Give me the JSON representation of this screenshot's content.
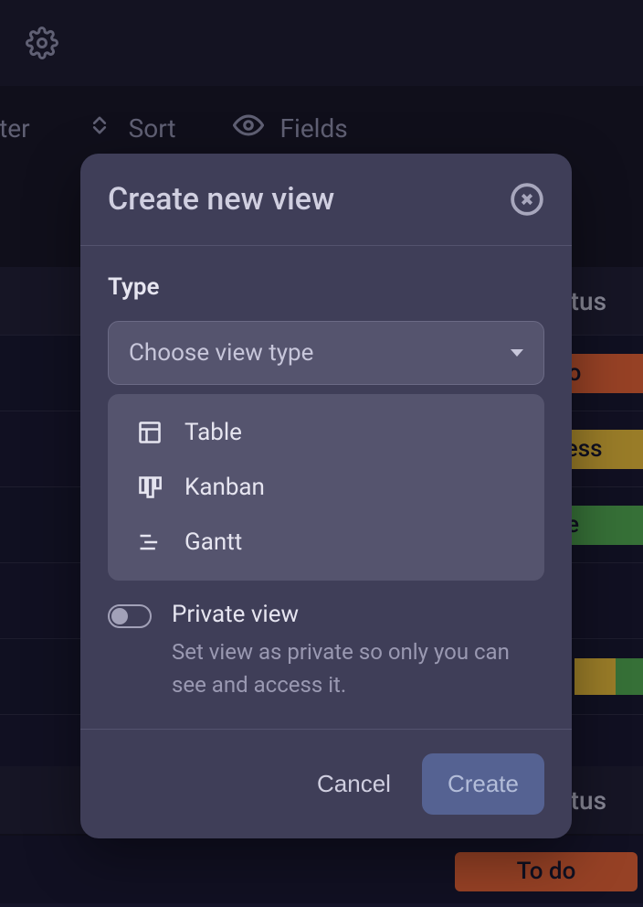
{
  "toolbar": {
    "filter": "Filter",
    "sort": "Sort",
    "fields": "Fields"
  },
  "table": {
    "header1": "Status",
    "header2": "Status",
    "rows": [
      {
        "status": "To do",
        "color": "todo"
      },
      {
        "status": "In progress",
        "color": "progress"
      },
      {
        "status": "Done",
        "color": "done"
      }
    ],
    "row2_status": "To do"
  },
  "modal": {
    "title": "Create new view",
    "type_label": "Type",
    "select_placeholder": "Choose view type",
    "options": {
      "table": "Table",
      "kanban": "Kanban",
      "gantt": "Gantt"
    },
    "private": {
      "title": "Private view",
      "desc": "Set view as private so only you can see and access it."
    },
    "cancel": "Cancel",
    "create": "Create"
  }
}
